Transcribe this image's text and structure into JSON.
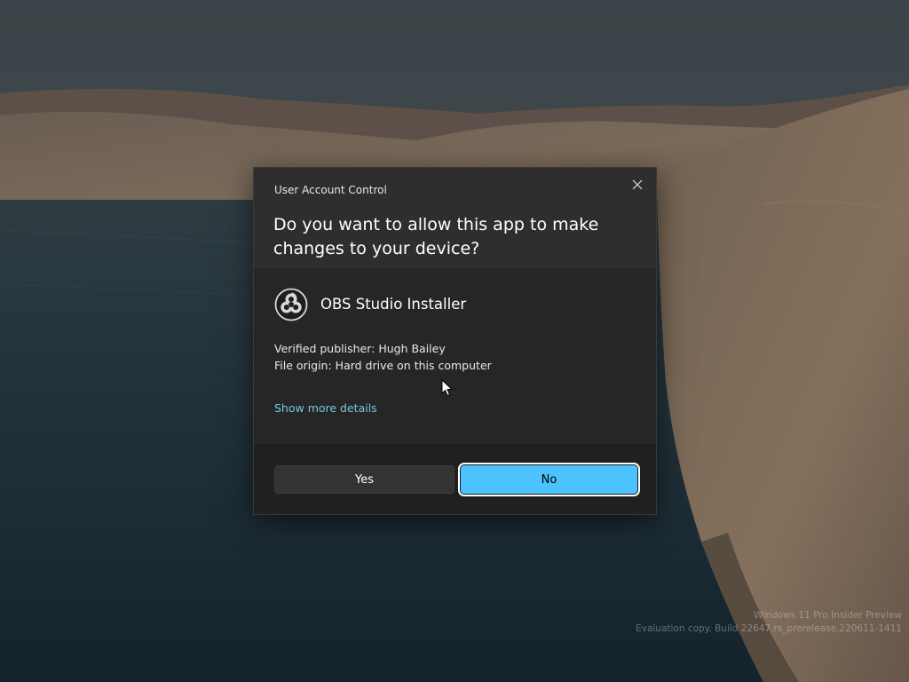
{
  "dialog": {
    "title": "User Account Control",
    "question": "Do you want to allow this app to make changes to your device?",
    "app_name": "OBS Studio Installer",
    "app_icon": "obs-logo-icon",
    "publisher": "Verified publisher: Hugh Bailey",
    "origin": "File origin: Hard drive on this computer",
    "details_link": "Show more details",
    "yes_label": "Yes",
    "no_label": "No",
    "close_icon": "close-icon",
    "colors": {
      "accent": "#4cc2ff",
      "link": "#77c7e0",
      "header_bg": "#2e2e2e",
      "body_bg": "#262626",
      "footer_bg": "#202020"
    }
  },
  "watermark": {
    "line1": "Windows 11 Pro Insider Preview",
    "line2": "Evaluation copy. Build 22647.rs_prerelease.220611-1411"
  }
}
